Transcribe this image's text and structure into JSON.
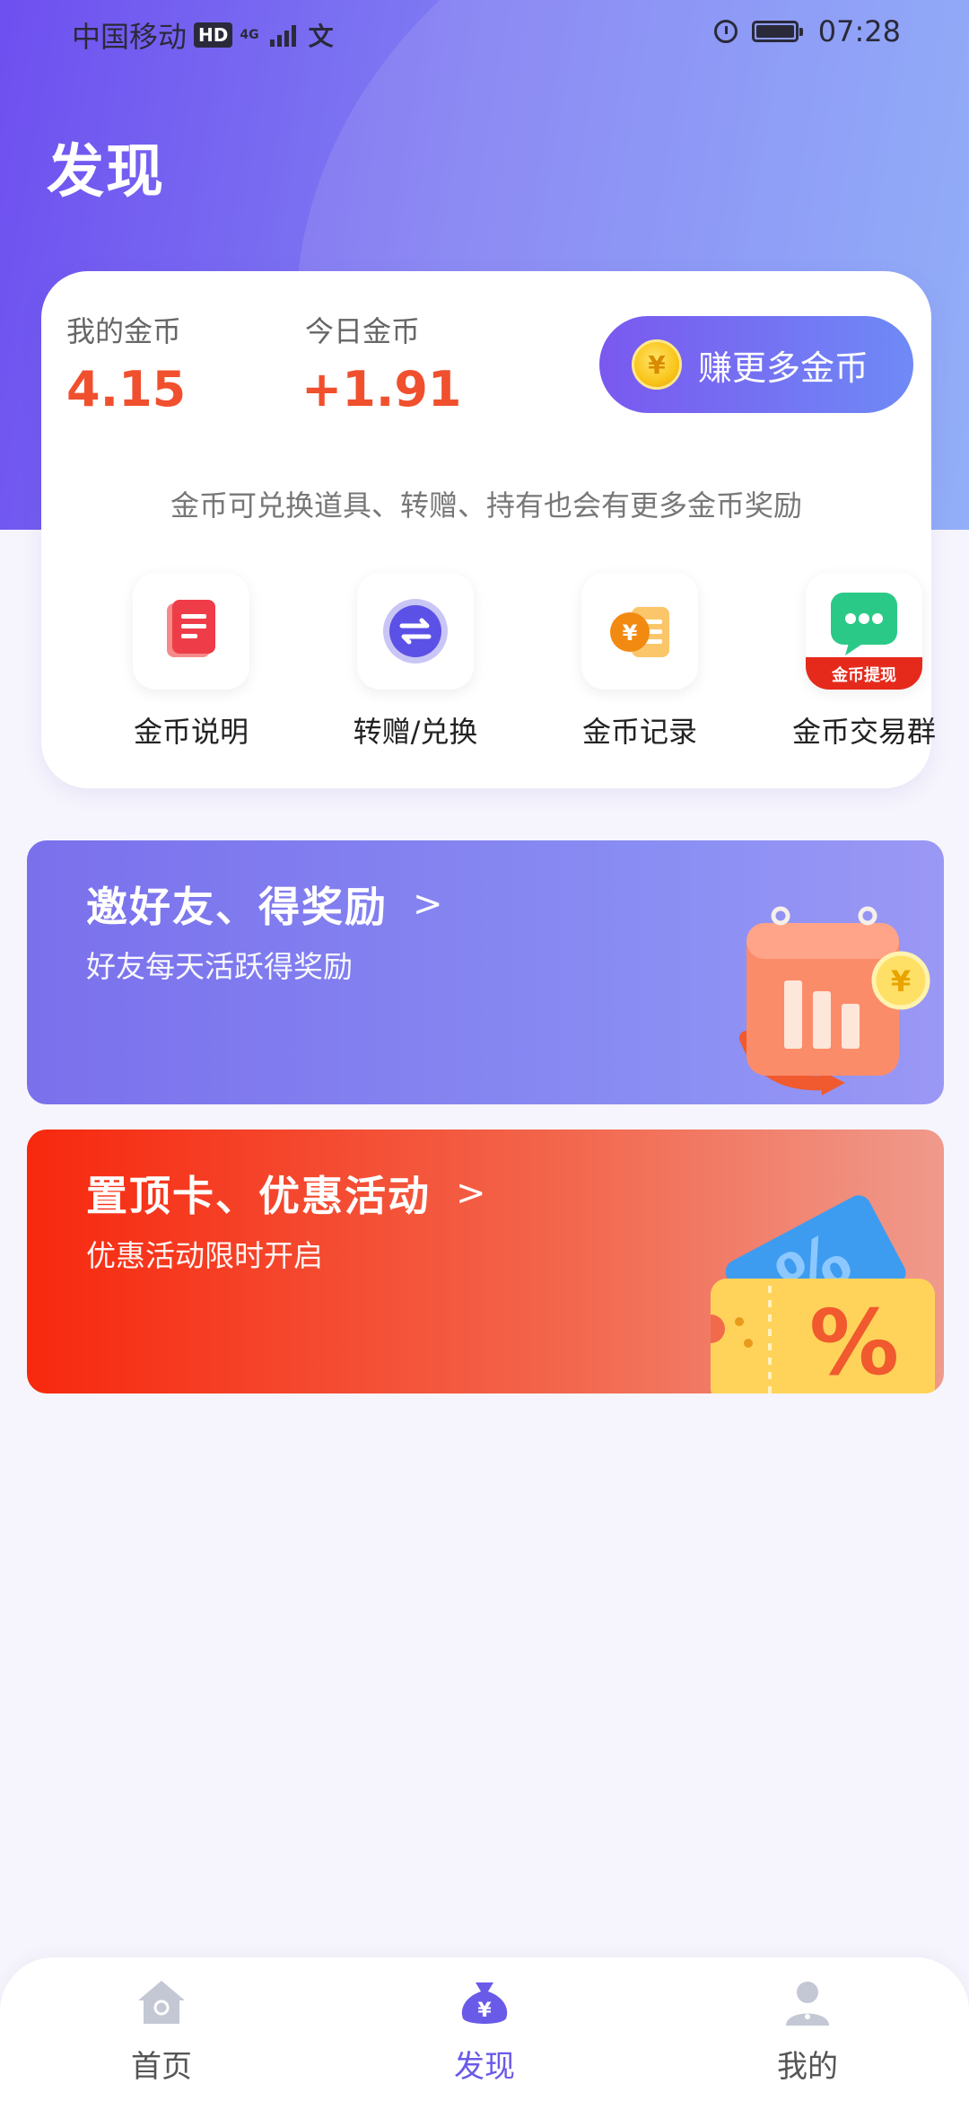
{
  "status_bar": {
    "carrier": "中国移动",
    "hd": "HD",
    "network": "4G",
    "time": "07:28"
  },
  "page": {
    "title": "发现"
  },
  "coins": {
    "my_label": "我的金币",
    "my_value": "4.15",
    "today_label": "今日金币",
    "today_value": "+1.91",
    "earn_button": "赚更多金币",
    "description": "金币可兑换道具、转赠、持有也会有更多金币奖励"
  },
  "menu": [
    {
      "label": "金币说明",
      "icon": "document-icon"
    },
    {
      "label": "转赠/兑换",
      "icon": "exchange-icon"
    },
    {
      "label": "金币记录",
      "icon": "coin-record-icon"
    },
    {
      "label": "金币交易群",
      "icon": "chat-icon",
      "badge": "金币提现"
    }
  ],
  "banners": [
    {
      "title": "邀好友、得奖励",
      "subtitle": "好友每天活跃得奖励",
      "icon": "calendar-gift-illustration"
    },
    {
      "title": "置顶卡、优惠活动",
      "subtitle": "优惠活动限时开启",
      "icon": "coupon-illustration"
    }
  ],
  "tabs": [
    {
      "label": "首页",
      "icon": "home-icon",
      "active": false
    },
    {
      "label": "发现",
      "icon": "money-bag-icon",
      "active": true
    },
    {
      "label": "我的",
      "icon": "user-icon",
      "active": false
    }
  ],
  "colors": {
    "accent": "#6a5ae8",
    "coin_value": "#f0502e",
    "tab_inactive": "#555555"
  }
}
